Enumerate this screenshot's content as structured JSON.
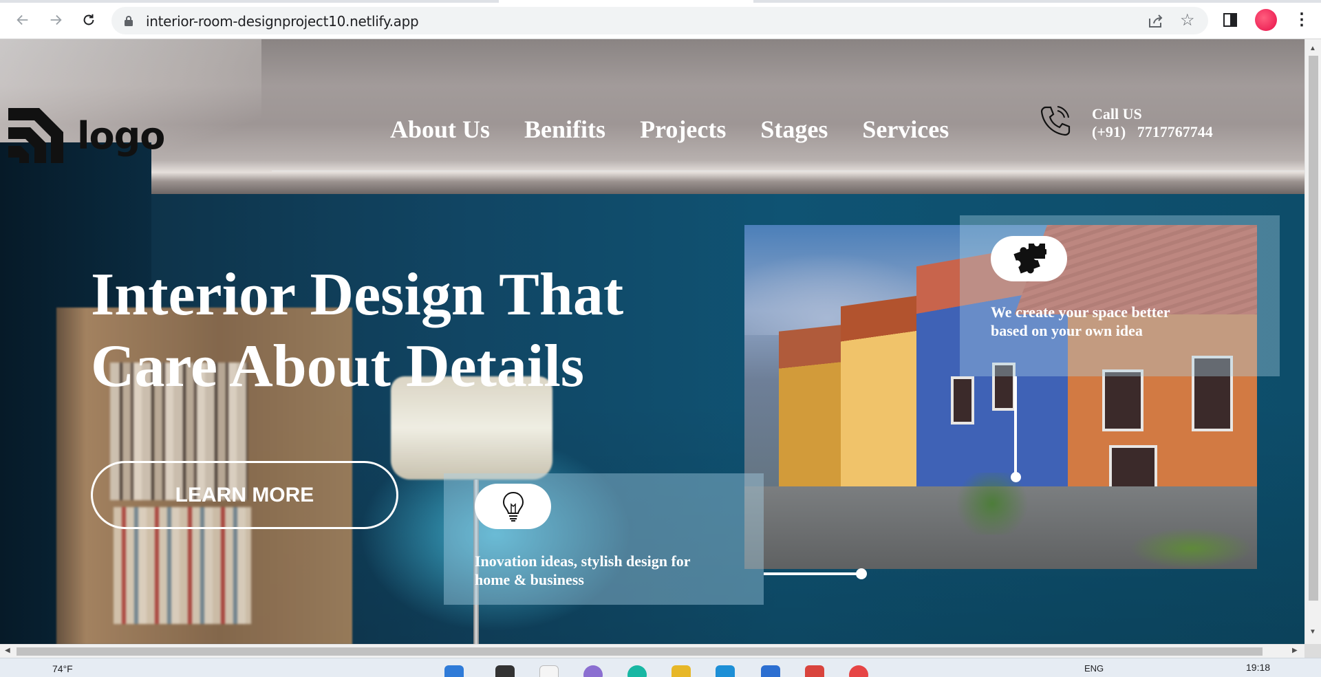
{
  "browser": {
    "url": "interior-room-designproject10.netlify.app"
  },
  "header": {
    "logo_text": "logo",
    "menu": [
      {
        "label": "About Us"
      },
      {
        "label": "Benifits"
      },
      {
        "label": "Projects"
      },
      {
        "label": "Stages"
      },
      {
        "label": "Services"
      }
    ],
    "call_label": "Call US",
    "call_number": "(+91)   7717767744"
  },
  "hero": {
    "title_line1": "Interior Design That",
    "title_line2": "Care About Details",
    "cta_label": "LEARN MORE"
  },
  "features": {
    "top": {
      "icon": "puzzle-icon",
      "text_line1": "We create your space better",
      "text_line2": "based on your own idea"
    },
    "bottom": {
      "icon": "lightbulb-icon",
      "text_line1": "Inovation ideas, stylish design for",
      "text_line2": "home & business"
    }
  },
  "taskbar": {
    "weather": "74°F",
    "language": "ENG",
    "time": "19:18"
  },
  "colors": {
    "wall_blue": "#114563",
    "text_white": "#ffffff",
    "profile_pink": "#e8104a"
  }
}
